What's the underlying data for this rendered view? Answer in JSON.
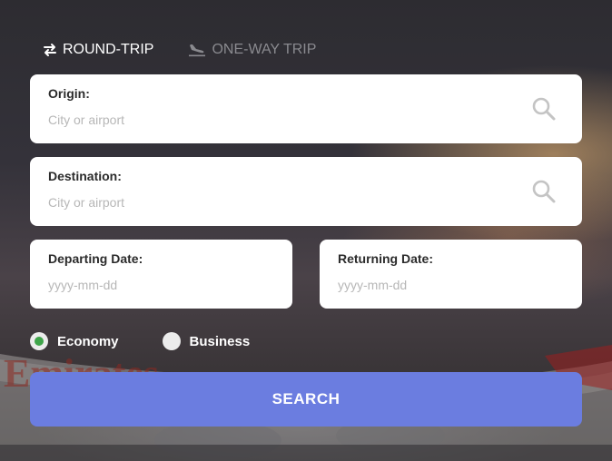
{
  "tabs": [
    {
      "label": "ROUND-TRIP",
      "icon": "swap-arrows-icon",
      "active": true
    },
    {
      "label": "ONE-WAY TRIP",
      "icon": "plane-landing-icon",
      "active": false
    }
  ],
  "origin": {
    "label": "Origin:",
    "placeholder": "City or airport",
    "value": ""
  },
  "destination": {
    "label": "Destination:",
    "placeholder": "City or airport",
    "value": ""
  },
  "departing": {
    "label": "Departing Date:",
    "placeholder": "yyyy-mm-dd",
    "value": ""
  },
  "returning": {
    "label": "Returning Date:",
    "placeholder": "yyyy-mm-dd",
    "value": ""
  },
  "cabin": {
    "options": [
      {
        "label": "Economy",
        "selected": true
      },
      {
        "label": "Business",
        "selected": false
      }
    ]
  },
  "search_button": {
    "label": "SEARCH"
  },
  "colors": {
    "accent": "#6b7de0",
    "radio_selected": "#3fa54a",
    "card": "#ffffff"
  }
}
